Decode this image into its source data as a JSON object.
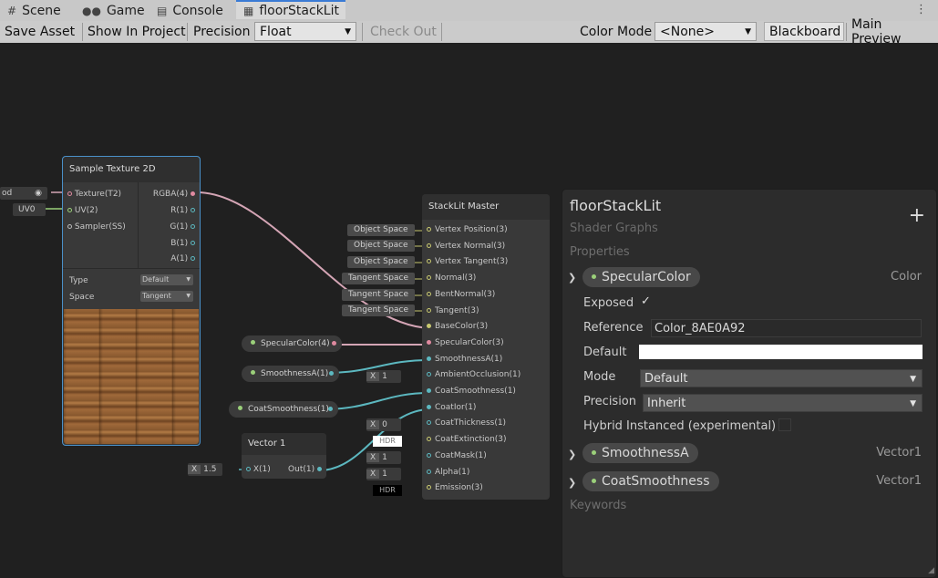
{
  "tabs": [
    {
      "label": "Scene",
      "icon": "grid-icon"
    },
    {
      "label": "Game",
      "icon": "gamepad-icon"
    },
    {
      "label": "Console",
      "icon": "console-icon"
    },
    {
      "label": "floorStackLit",
      "icon": "shadergraph-icon",
      "active": true
    }
  ],
  "toolbar": {
    "save_asset": "Save Asset",
    "show_in_project": "Show In Project",
    "precision_label": "Precision",
    "precision_value": "Float",
    "check_out": "Check Out",
    "color_mode_label": "Color Mode",
    "color_mode_value": "<None>",
    "blackboard": "Blackboard",
    "main_preview": "Main Preview"
  },
  "graph": {
    "sample_texture": {
      "title": "Sample Texture 2D",
      "inputs": [
        "Texture(T2)",
        "UV(2)",
        "Sampler(SS)"
      ],
      "outputs": [
        "RGBA(4)",
        "R(1)",
        "G(1)",
        "B(1)",
        "A(1)"
      ],
      "type_label": "Type",
      "type_value": "Default",
      "space_label": "Space",
      "space_value": "Tangent",
      "tex_input": "od",
      "uv_input": "UV0"
    },
    "master": {
      "title": "StackLit Master",
      "ports": [
        "Vertex Position(3)",
        "Vertex Normal(3)",
        "Vertex Tangent(3)",
        "Normal(3)",
        "BentNormal(3)",
        "Tangent(3)",
        "BaseColor(3)",
        "SpecularColor(3)",
        "SmoothnessA(1)",
        "AmbientOcclusion(1)",
        "CoatSmoothness(1)",
        "CoatIor(1)",
        "CoatThickness(1)",
        "CoatExtinction(3)",
        "CoatMask(1)",
        "Alpha(1)",
        "Emission(3)"
      ],
      "space_inputs": [
        "Object Space",
        "Object Space",
        "Object Space",
        "Tangent Space",
        "Tangent Space",
        "Tangent Space"
      ],
      "ao_value": "1",
      "thickness_value": "0",
      "hdr_label": "HDR",
      "mask_value": "1",
      "alpha_value": "1",
      "x_label": "X"
    },
    "properties_nodes": [
      "SpecularColor(4)",
      "SmoothnessA(1)",
      "CoatSmoothness(1)"
    ],
    "vector1": {
      "title": "Vector 1",
      "in": "X(1)",
      "out": "Out(1)",
      "x_value": "1.5",
      "x_label": "X"
    }
  },
  "blackboard": {
    "title": "floorStackLit",
    "subtitle": "Shader Graphs",
    "properties_label": "Properties",
    "keywords_label": "Keywords",
    "props": [
      {
        "name": "SpecularColor",
        "type": "Color"
      },
      {
        "name": "SmoothnessA",
        "type": "Vector1"
      },
      {
        "name": "CoatSmoothness",
        "type": "Vector1"
      }
    ],
    "fields": {
      "exposed_label": "Exposed",
      "reference_label": "Reference",
      "reference_value": "Color_8AE0A92",
      "default_label": "Default",
      "mode_label": "Mode",
      "mode_value": "Default",
      "precision_label": "Precision",
      "precision_value": "Inherit",
      "hybrid_label": "Hybrid Instanced (experimental)"
    }
  },
  "colors": {
    "accent": "#3a7bd5",
    "wire_pink": "#d4a5b5",
    "wire_cyan": "#5cb8c0",
    "wire_yellow": "#c8c870",
    "port_green": "#9bd07a"
  }
}
